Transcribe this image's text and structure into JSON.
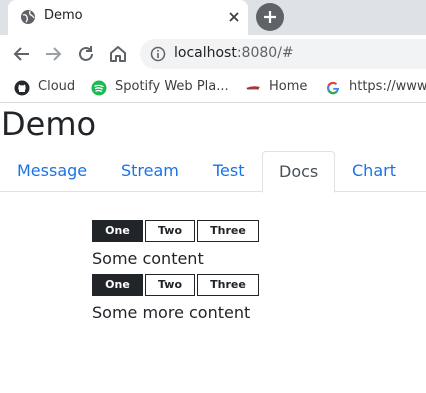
{
  "browser": {
    "tab_title": "Demo",
    "url_host": "localhost",
    "url_rest": ":8080/#",
    "bookmarks": [
      {
        "label": "Cloud",
        "icon": "github-icon"
      },
      {
        "label": "Spotify Web Pla...",
        "icon": "spotify-icon"
      },
      {
        "label": "Home",
        "icon": "home-bookmark-icon"
      },
      {
        "label": "https://www",
        "icon": "google-icon"
      }
    ]
  },
  "page": {
    "title": "Demo",
    "tabs": [
      {
        "label": "Message",
        "active": false
      },
      {
        "label": "Stream",
        "active": false
      },
      {
        "label": "Test",
        "active": false
      },
      {
        "label": "Docs",
        "active": true
      },
      {
        "label": "Chart",
        "active": false
      }
    ],
    "groups": [
      {
        "buttons": [
          "One",
          "Two",
          "Three"
        ],
        "selected": "One",
        "content": "Some content"
      },
      {
        "buttons": [
          "One",
          "Two",
          "Three"
        ],
        "selected": "One",
        "content": "Some more content"
      }
    ]
  },
  "colors": {
    "link": "#1a73e8",
    "active_button": "#212529"
  }
}
